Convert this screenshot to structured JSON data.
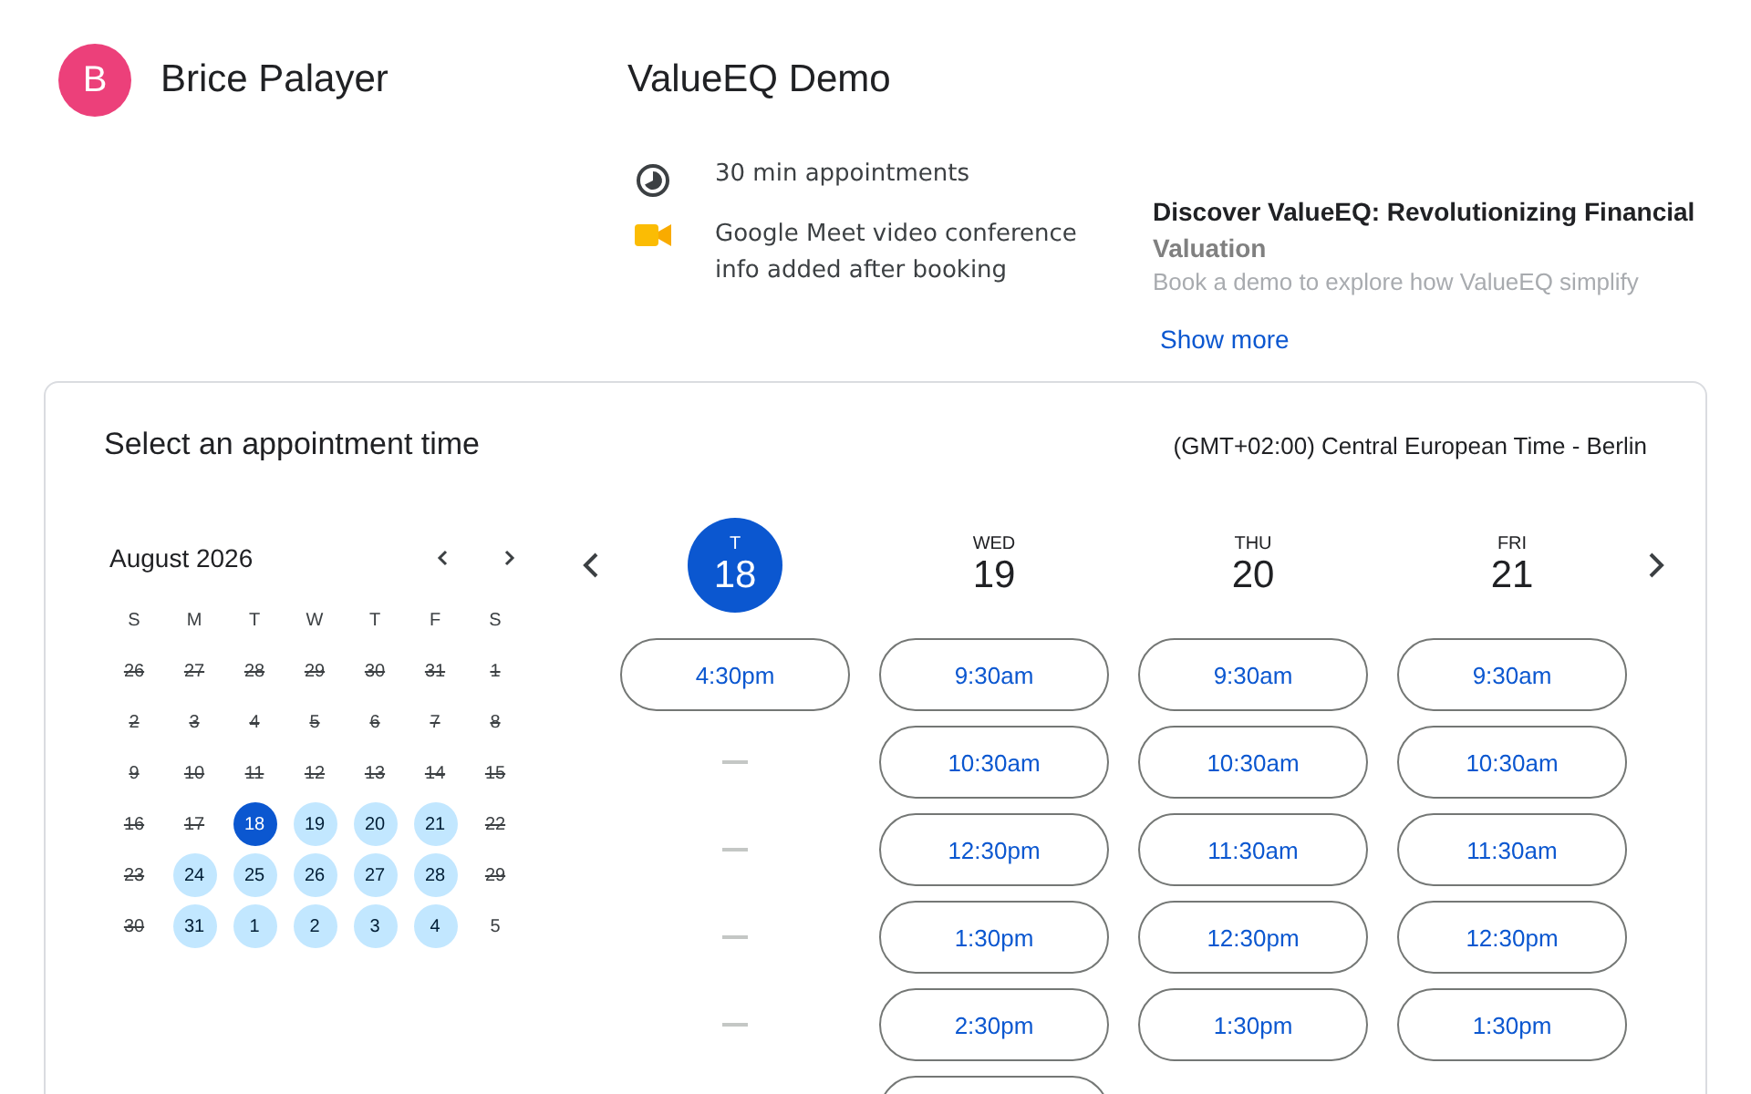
{
  "host": {
    "avatar_letter": "B",
    "name": "Brice Palayer"
  },
  "event": {
    "title": "ValueEQ Demo",
    "duration": "30 min appointments",
    "conference": "Google Meet video conference info added after booking",
    "description_title": "Discover ValueEQ: Revolutionizing Financial",
    "description_subtitle": "Valuation",
    "description_excerpt": "Book a demo to explore how ValueEQ simplify",
    "show_more": "Show more"
  },
  "booking": {
    "title": "Select an appointment time",
    "timezone": "(GMT+02:00) Central European Time - Berlin",
    "calendar": {
      "month": "August 2026",
      "weekdays": [
        "S",
        "M",
        "T",
        "W",
        "T",
        "F",
        "S"
      ],
      "days": [
        {
          "label": "26",
          "past": true,
          "available": false,
          "selected": false
        },
        {
          "label": "27",
          "past": true,
          "available": false,
          "selected": false
        },
        {
          "label": "28",
          "past": true,
          "available": false,
          "selected": false
        },
        {
          "label": "29",
          "past": true,
          "available": false,
          "selected": false
        },
        {
          "label": "30",
          "past": true,
          "available": false,
          "selected": false
        },
        {
          "label": "31",
          "past": true,
          "available": false,
          "selected": false
        },
        {
          "label": "1",
          "past": true,
          "available": false,
          "selected": false
        },
        {
          "label": "2",
          "past": true,
          "available": false,
          "selected": false
        },
        {
          "label": "3",
          "past": true,
          "available": false,
          "selected": false
        },
        {
          "label": "4",
          "past": true,
          "available": false,
          "selected": false
        },
        {
          "label": "5",
          "past": true,
          "available": false,
          "selected": false
        },
        {
          "label": "6",
          "past": true,
          "available": false,
          "selected": false
        },
        {
          "label": "7",
          "past": true,
          "available": false,
          "selected": false
        },
        {
          "label": "8",
          "past": true,
          "available": false,
          "selected": false
        },
        {
          "label": "9",
          "past": true,
          "available": false,
          "selected": false
        },
        {
          "label": "10",
          "past": true,
          "available": false,
          "selected": false
        },
        {
          "label": "11",
          "past": true,
          "available": false,
          "selected": false
        },
        {
          "label": "12",
          "past": true,
          "available": false,
          "selected": false
        },
        {
          "label": "13",
          "past": true,
          "available": false,
          "selected": false
        },
        {
          "label": "14",
          "past": true,
          "available": false,
          "selected": false
        },
        {
          "label": "15",
          "past": true,
          "available": false,
          "selected": false
        },
        {
          "label": "16",
          "past": true,
          "available": false,
          "selected": false
        },
        {
          "label": "17",
          "past": true,
          "available": false,
          "selected": false
        },
        {
          "label": "18",
          "past": false,
          "available": true,
          "selected": true
        },
        {
          "label": "19",
          "past": false,
          "available": true,
          "selected": false
        },
        {
          "label": "20",
          "past": false,
          "available": true,
          "selected": false
        },
        {
          "label": "21",
          "past": false,
          "available": true,
          "selected": false
        },
        {
          "label": "22",
          "past": true,
          "available": false,
          "selected": false
        },
        {
          "label": "23",
          "past": true,
          "available": false,
          "selected": false
        },
        {
          "label": "24",
          "past": false,
          "available": true,
          "selected": false
        },
        {
          "label": "25",
          "past": false,
          "available": true,
          "selected": false
        },
        {
          "label": "26",
          "past": false,
          "available": true,
          "selected": false
        },
        {
          "label": "27",
          "past": false,
          "available": true,
          "selected": false
        },
        {
          "label": "28",
          "past": false,
          "available": true,
          "selected": false
        },
        {
          "label": "29",
          "past": true,
          "available": false,
          "selected": false
        },
        {
          "label": "30",
          "past": true,
          "available": false,
          "selected": false
        },
        {
          "label": "31",
          "past": false,
          "available": true,
          "selected": false
        },
        {
          "label": "1",
          "past": false,
          "available": true,
          "selected": false
        },
        {
          "label": "2",
          "past": false,
          "available": true,
          "selected": false
        },
        {
          "label": "3",
          "past": false,
          "available": true,
          "selected": false
        },
        {
          "label": "4",
          "past": false,
          "available": true,
          "selected": false
        },
        {
          "label": "5",
          "past": false,
          "available": false,
          "selected": false
        }
      ]
    },
    "columns": [
      {
        "weekday": "T",
        "date": "18",
        "selected": true,
        "slots": [
          {
            "kind": "time",
            "label": "4:30pm"
          },
          {
            "kind": "empty"
          },
          {
            "kind": "empty"
          },
          {
            "kind": "empty"
          },
          {
            "kind": "empty"
          }
        ]
      },
      {
        "weekday": "WED",
        "date": "19",
        "selected": false,
        "slots": [
          {
            "kind": "time",
            "label": "9:30am"
          },
          {
            "kind": "time",
            "label": "10:30am"
          },
          {
            "kind": "time",
            "label": "12:30pm"
          },
          {
            "kind": "time",
            "label": "1:30pm"
          },
          {
            "kind": "time",
            "label": "2:30pm"
          },
          {
            "kind": "cut"
          }
        ]
      },
      {
        "weekday": "THU",
        "date": "20",
        "selected": false,
        "slots": [
          {
            "kind": "time",
            "label": "9:30am"
          },
          {
            "kind": "time",
            "label": "10:30am"
          },
          {
            "kind": "time",
            "label": "11:30am"
          },
          {
            "kind": "time",
            "label": "12:30pm"
          },
          {
            "kind": "time",
            "label": "1:30pm"
          }
        ]
      },
      {
        "weekday": "FRI",
        "date": "21",
        "selected": false,
        "slots": [
          {
            "kind": "time",
            "label": "9:30am"
          },
          {
            "kind": "time",
            "label": "10:30am"
          },
          {
            "kind": "time",
            "label": "11:30am"
          },
          {
            "kind": "time",
            "label": "12:30pm"
          },
          {
            "kind": "time",
            "label": "1:30pm"
          }
        ]
      }
    ]
  }
}
